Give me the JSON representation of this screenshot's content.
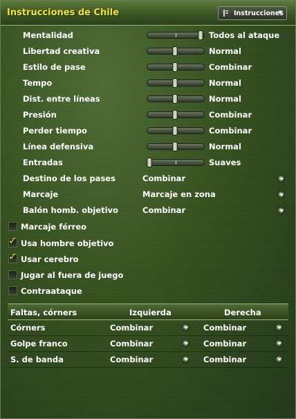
{
  "header": {
    "title": "Instrucciones de Chile",
    "menu_button_label": "Instrucciones"
  },
  "sliders": [
    {
      "label": "Mentalidad",
      "value": "Todos al ataque",
      "level": 1.0
    },
    {
      "label": "Libertad creativa",
      "value": "Normal",
      "level": 0.5
    },
    {
      "label": "Estilo de pase",
      "value": "Combinar",
      "level": 0.5
    },
    {
      "label": "Tempo",
      "value": "Normal",
      "level": 0.5
    },
    {
      "label": "Dist. entre líneas",
      "value": "Normal",
      "level": 0.5
    },
    {
      "label": "Presión",
      "value": "Combinar",
      "level": 0.5
    },
    {
      "label": "Perder tiempo",
      "value": "Combinar",
      "level": 0.5
    },
    {
      "label": "Línea defensiva",
      "value": "Normal",
      "level": 0.5
    },
    {
      "label": "Entradas",
      "value": "Suaves",
      "level": 0.0
    }
  ],
  "dropdowns": [
    {
      "label": "Destino de los pases",
      "value": "Combinar"
    },
    {
      "label": "Marcaje",
      "value": "Marcaje en zona"
    },
    {
      "label": "Balón homb. objetivo",
      "value": "Combinar"
    }
  ],
  "checkboxes": [
    {
      "label": "Marcaje férreo",
      "checked": false
    },
    {
      "label": "Usa hombre objetivo",
      "checked": true
    },
    {
      "label": "Usar cerebro",
      "checked": true
    },
    {
      "label": "Jugar al fuera de juego",
      "checked": false
    },
    {
      "label": "Contraataque",
      "checked": false
    }
  ],
  "set_pieces": {
    "columns": [
      "Faltas, córners",
      "Izquierda",
      "Derecha"
    ],
    "rows": [
      {
        "label": "Córners",
        "left": "Combinar",
        "right": "Combinar"
      },
      {
        "label": "Golpe franco",
        "left": "Combinar",
        "right": "Combinar"
      },
      {
        "label": "S. de banda",
        "left": "Combinar",
        "right": "Combinar"
      }
    ]
  },
  "colors": {
    "title": "#f1e23b",
    "check": "#f0de2e",
    "text": "#ffffff"
  }
}
